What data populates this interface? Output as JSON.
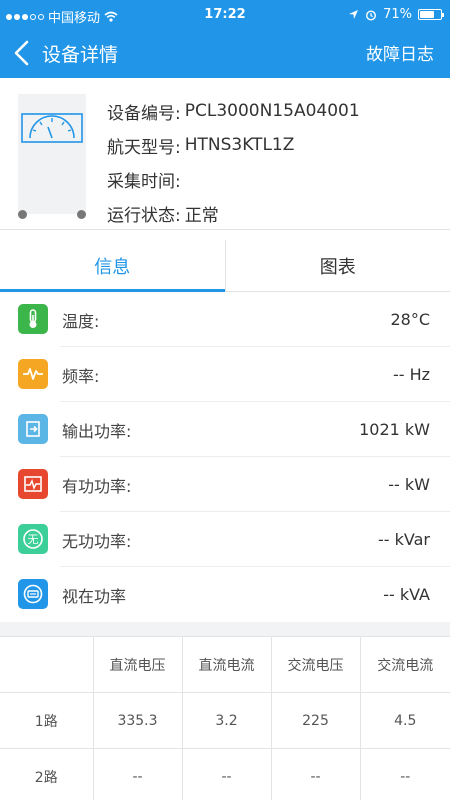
{
  "status_bar": {
    "carrier": "中国移动",
    "time": "17:22",
    "battery": "71%",
    "battery_level": 0.71
  },
  "nav": {
    "title": "设备详情",
    "action": "故障日志"
  },
  "device": {
    "serial_label": "设备编号:",
    "serial_value": "PCL3000N15A04001",
    "model_label": "航天型号:",
    "model_value": "HTNS3KTL1Z",
    "time_label": "采集时间:",
    "time_value": "",
    "state_label": "运行状态:",
    "state_value": "正常"
  },
  "tabs": [
    {
      "label": "信息",
      "active": true
    },
    {
      "label": "图表",
      "active": false
    }
  ],
  "metrics": [
    {
      "label": "温度:",
      "value": "28°C",
      "icon": "thermometer-icon",
      "color": "#3cb54a"
    },
    {
      "label": "频率:",
      "value": "-- Hz",
      "icon": "waveform-icon",
      "color": "#f5a623"
    },
    {
      "label": "输出功率:",
      "value": "1021 kW",
      "icon": "output-power-icon",
      "color": "#5bb5e5"
    },
    {
      "label": "有功功率:",
      "value": "-- kW",
      "icon": "active-power-icon",
      "color": "#e8472f"
    },
    {
      "label": "无功功率:",
      "value": "-- kVar",
      "icon": "reactive-power-icon",
      "color": "#3ccf9a",
      "glyph": "无"
    },
    {
      "label": "视在功率",
      "value": "-- kVA",
      "icon": "apparent-power-icon",
      "color": "#2196e8"
    }
  ],
  "table": {
    "headers": [
      "",
      "直流电压",
      "直流电流",
      "交流电压",
      "交流电流"
    ],
    "rows": [
      [
        "1路",
        "335.3",
        "3.2",
        "225",
        "4.5"
      ],
      [
        "2路",
        "--",
        "--",
        "--",
        "--"
      ]
    ]
  }
}
